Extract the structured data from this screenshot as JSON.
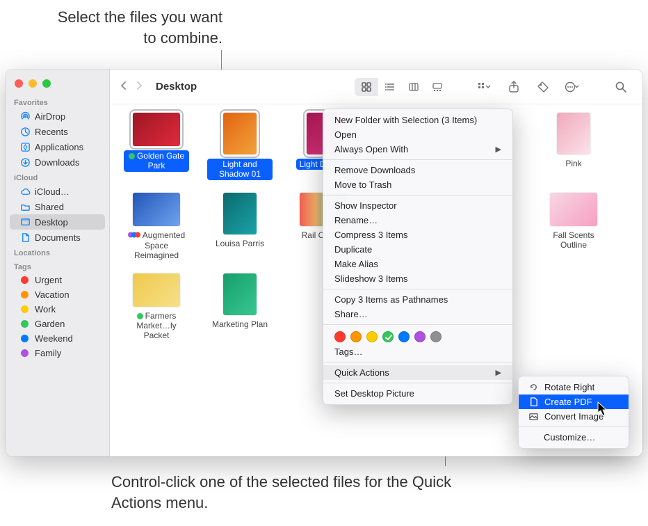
{
  "annotations": {
    "top": "Select the files you want to combine.",
    "bottom": "Control-click one of the selected files for the Quick Actions menu."
  },
  "window": {
    "title": "Desktop"
  },
  "sidebar": {
    "favorites_label": "Favorites",
    "favorites": [
      {
        "icon": "airdrop",
        "label": "AirDrop"
      },
      {
        "icon": "clock",
        "label": "Recents"
      },
      {
        "icon": "apps",
        "label": "Applications"
      },
      {
        "icon": "download",
        "label": "Downloads"
      }
    ],
    "icloud_label": "iCloud",
    "icloud": [
      {
        "icon": "cloud",
        "label": "iCloud…"
      },
      {
        "icon": "folder",
        "label": "Shared"
      },
      {
        "icon": "desktop",
        "label": "Desktop",
        "active": true
      },
      {
        "icon": "doc",
        "label": "Documents"
      }
    ],
    "locations_label": "Locations",
    "tags_label": "Tags",
    "tags": [
      {
        "color": "#ff3b30",
        "label": "Urgent"
      },
      {
        "color": "#ff9500",
        "label": "Vacation"
      },
      {
        "color": "#ffcc00",
        "label": "Work"
      },
      {
        "color": "#34c759",
        "label": "Garden"
      },
      {
        "color": "#007aff",
        "label": "Weekend"
      },
      {
        "color": "#af52de",
        "label": "Family"
      }
    ]
  },
  "files": {
    "row1": [
      {
        "name": "Golden Gate Park",
        "thumb": "t-red",
        "selected": true,
        "tag": "#34c759"
      },
      {
        "name": "Light and Shadow 01",
        "thumb": "t-orange",
        "selected": true,
        "tall": true
      },
      {
        "name": "Light Display",
        "thumb": "t-mag",
        "selected": true,
        "tall": true
      },
      {
        "name": "",
        "thumb": "",
        "placeholder": true
      },
      {
        "name": "",
        "thumb": "",
        "placeholder": true
      },
      {
        "name": "Pink",
        "thumb": "t-pink",
        "tall": true
      }
    ],
    "row2": [
      {
        "name": "Augmented Space Reimagined",
        "thumb": "t-blue",
        "multitag": true
      },
      {
        "name": "Louisa Parris",
        "thumb": "t-teal",
        "tall": true
      },
      {
        "name": "Rail Chaser",
        "thumb": "t-colorful"
      },
      {
        "name": "",
        "thumb": "",
        "placeholder": true
      },
      {
        "name": "",
        "thumb": "",
        "placeholder": true
      },
      {
        "name": "Fall Scents Outline",
        "thumb": "t-scents"
      }
    ],
    "row3": [
      {
        "name": "Farmers Market…ly Packet",
        "thumb": "t-yellow",
        "tag": "#34c759"
      },
      {
        "name": "Marketing Plan",
        "thumb": "t-greenpdf",
        "tall": true
      }
    ]
  },
  "context_menu": {
    "items1": [
      {
        "label": "New Folder with Selection (3 Items)"
      },
      {
        "label": "Open"
      },
      {
        "label": "Always Open With",
        "arrow": true
      }
    ],
    "items2": [
      {
        "label": "Remove Downloads"
      },
      {
        "label": "Move to Trash"
      }
    ],
    "items3": [
      {
        "label": "Show Inspector"
      },
      {
        "label": "Rename…"
      },
      {
        "label": "Compress 3 Items"
      },
      {
        "label": "Duplicate"
      },
      {
        "label": "Make Alias"
      },
      {
        "label": "Slideshow 3 Items"
      }
    ],
    "items4": [
      {
        "label": "Copy 3 Items as Pathnames"
      },
      {
        "label": "Share…"
      }
    ],
    "tag_colors": [
      "#ff3b30",
      "#ff9500",
      "#ffcc00",
      "#34c759",
      "#007aff",
      "#af52de",
      "#8e8e93"
    ],
    "tag_selected_index": 3,
    "tags_label": "Tags…",
    "quick_actions": "Quick Actions",
    "set_desktop": "Set Desktop Picture"
  },
  "submenu": {
    "items": [
      {
        "icon": "rotate",
        "label": "Rotate Right"
      },
      {
        "icon": "pdf",
        "label": "Create PDF",
        "highlight": true
      },
      {
        "icon": "convert",
        "label": "Convert Image"
      }
    ],
    "customize": "Customize…"
  }
}
